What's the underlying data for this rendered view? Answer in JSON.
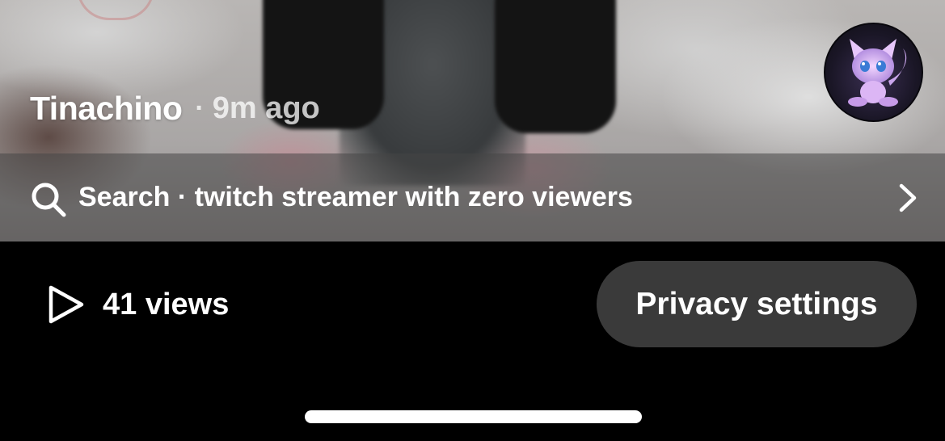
{
  "post": {
    "author": "Tinachino",
    "separator": "·",
    "time_ago": "9m ago",
    "avatar_icon": "cat-creature-avatar"
  },
  "search": {
    "icon": "search-icon",
    "label": "Search · twitch streamer with zero viewers",
    "chevron_icon": "chevron-right-icon"
  },
  "stats": {
    "icon": "play-icon",
    "views_label": "41 views"
  },
  "actions": {
    "privacy_label": "Privacy settings"
  },
  "colors": {
    "background": "#000000",
    "button_bg": "#3a3a3a",
    "text": "#ffffff"
  }
}
